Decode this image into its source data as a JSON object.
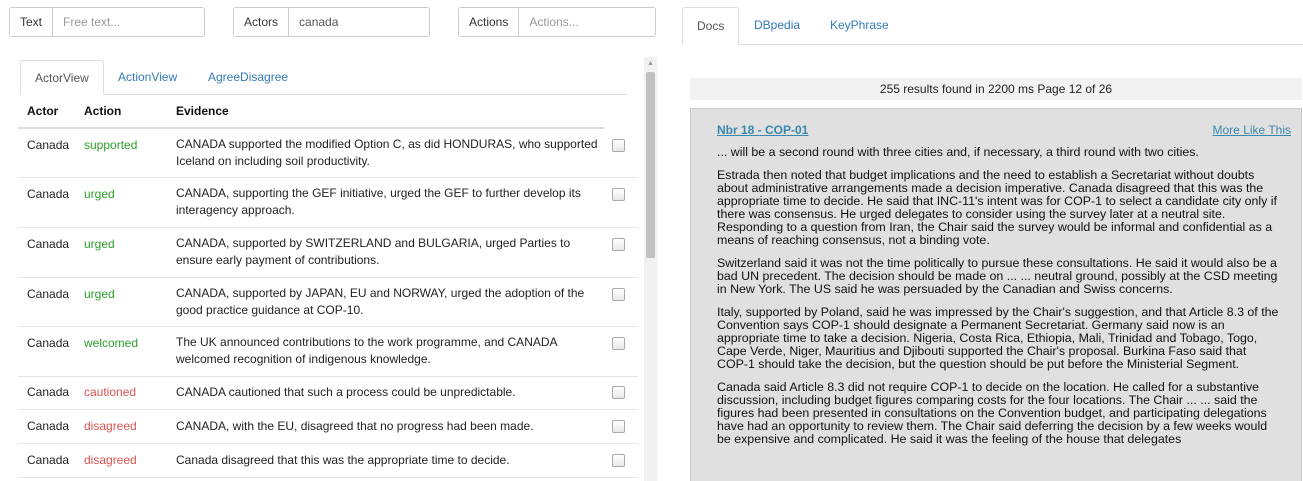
{
  "filters": {
    "text": {
      "label": "Text",
      "placeholder": "Free text..."
    },
    "actors": {
      "label": "Actors",
      "value": "canada"
    },
    "actions": {
      "label": "Actions",
      "placeholder": "Actions..."
    }
  },
  "left_tabs": [
    "ActorView",
    "ActionView",
    "AgreeDisagree"
  ],
  "table": {
    "headers": [
      "Actor",
      "Action",
      "Evidence"
    ],
    "rows": [
      {
        "actor": "Canada",
        "action": "supported",
        "evidence": "CANADA supported the modified Option C, as did HONDURAS, who supported Iceland on including soil productivity."
      },
      {
        "actor": "Canada",
        "action": "urged",
        "evidence": "CANADA, supporting the GEF initiative, urged the GEF to further develop its interagency approach."
      },
      {
        "actor": "Canada",
        "action": "urged",
        "evidence": "CANADA, supported by SWITZERLAND and BULGARIA, urged Parties to ensure early payment of contributions."
      },
      {
        "actor": "Canada",
        "action": "urged",
        "evidence": "CANADA, supported by JAPAN, EU and NORWAY, urged the adoption of the good practice guidance at COP-10."
      },
      {
        "actor": "Canada",
        "action": "welcomed",
        "evidence": "The UK announced contributions to the work programme, and CANADA welcomed recognition of indigenous knowledge."
      },
      {
        "actor": "Canada",
        "action": "cautioned",
        "evidence": "CANADA cautioned that such a process could be unpredictable."
      },
      {
        "actor": "Canada",
        "action": "disagreed",
        "evidence": "CANADA, with the EU, disagreed that no progress had been made."
      },
      {
        "actor": "Canada",
        "action": "disagreed",
        "evidence": "Canada disagreed that this was the appropriate time to decide."
      }
    ]
  },
  "right_tabs": [
    "Docs",
    "DBpedia",
    "KeyPhrase"
  ],
  "results_text": "255 results found in 2200 ms Page 12 of 26",
  "doc": {
    "title": "Nbr 18 - COP-01",
    "more_like": "More Like This",
    "paragraphs": [
      "... will be a second round with three cities and, if necessary, a third round with two cities.",
      "Estrada then noted that budget implications and the need to establish a Secretariat without doubts about administrative arrangements made a decision imperative. Canada disagreed that this was the appropriate time to decide. He said that INC-11's intent was for COP-1 to select a candidate city only if there was consensus. He urged delegates to consider using the survey later at a neutral site. Responding to a question from Iran, the Chair said the survey would be informal and confidential as a means of reaching consensus, not a binding vote.",
      "Switzerland said it was not the time politically to pursue these consultations. He said it would also be a bad UN precedent. The decision should be made on ... ... neutral ground, possibly at the CSD meeting in New York. The US said he was persuaded by the Canadian and Swiss concerns.",
      "Italy, supported by Poland, said he was impressed by the Chair's suggestion, and that Article 8.3 of the Convention says COP-1 should designate a Permanent Secretariat. Germany said now is an appropriate time to take a decision. Nigeria, Costa Rica, Ethiopia, Mali, Trinidad and Tobago, Togo, Cape Verde, Niger, Mauritius and Djibouti supported the Chair's proposal. Burkina Faso said that COP-1 should take the decision, but the question should be put before the Ministerial Segment.",
      "Canada said Article 8.3 did not require COP-1 to decide on the location. He called for a substantive discussion, including budget figures comparing costs for the four locations. The Chair ... ... said the figures had been presented in consultations on the Convention budget, and participating delegations have had an opportunity to review them. The Chair said deferring the decision by a few weeks would be expensive and complicated. He said it was the feeling of the house that delegates"
    ]
  },
  "colors": {
    "link": "#337ab7",
    "positive": "#2ca02c",
    "negative": "#d9534f"
  }
}
